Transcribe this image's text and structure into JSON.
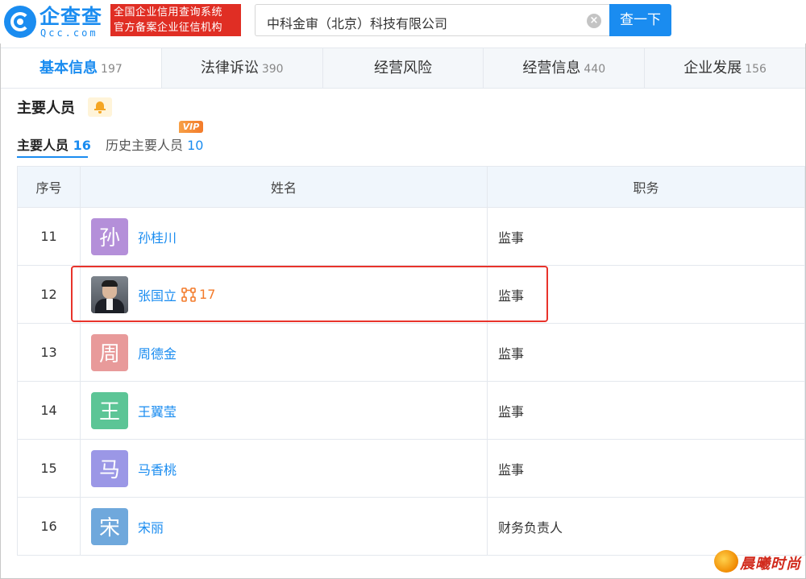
{
  "header": {
    "logo_name": "企查查",
    "logo_domain": "Qcc.com",
    "slogan_line1": "全国企业信用查询系统",
    "slogan_line2": "官方备案企业征信机构",
    "search_value": "中科金审（北京）科技有限公司",
    "search_button": "查一下",
    "clear_symbol": "×"
  },
  "tabs": [
    {
      "label": "基本信息",
      "count": "197",
      "active": true
    },
    {
      "label": "法律诉讼",
      "count": "390",
      "active": false
    },
    {
      "label": "经营风险",
      "count": "",
      "active": false
    },
    {
      "label": "经营信息",
      "count": "440",
      "active": false
    },
    {
      "label": "企业发展",
      "count": "156",
      "active": false
    }
  ],
  "section": {
    "title": "主要人员",
    "subtab_current_label": "主要人员",
    "subtab_current_count": "16",
    "subtab_history_label": "历史主要人员",
    "subtab_history_count": "10",
    "vip_badge": "VIP"
  },
  "table": {
    "headers": [
      "序号",
      "姓名",
      "职务"
    ],
    "rows": [
      {
        "index": "11",
        "avatar_char": "孙",
        "avatar_color": "#b48fd9",
        "name": "孙桂川",
        "role": "监事"
      },
      {
        "index": "12",
        "avatar_char": "",
        "avatar_color": "#5a5f66",
        "name": "张国立",
        "related_count": "17",
        "role": "监事"
      },
      {
        "index": "13",
        "avatar_char": "周",
        "avatar_color": "#e89a9a",
        "name": "周德金",
        "role": "监事"
      },
      {
        "index": "14",
        "avatar_char": "王",
        "avatar_color": "#5cc596",
        "name": "王翼莹",
        "role": "监事"
      },
      {
        "index": "15",
        "avatar_char": "马",
        "avatar_color": "#9b97e6",
        "name": "马香桃",
        "role": "监事"
      },
      {
        "index": "16",
        "avatar_char": "宋",
        "avatar_color": "#6fa8dc",
        "name": "宋丽",
        "role": "财务负责人"
      }
    ]
  },
  "watermark": {
    "text": "晨曦时尚"
  },
  "colors": {
    "brand": "#1a8cf0",
    "slogan_bg": "#e02e24",
    "highlight": "#e8332b",
    "link_count": "#f37b2b"
  }
}
